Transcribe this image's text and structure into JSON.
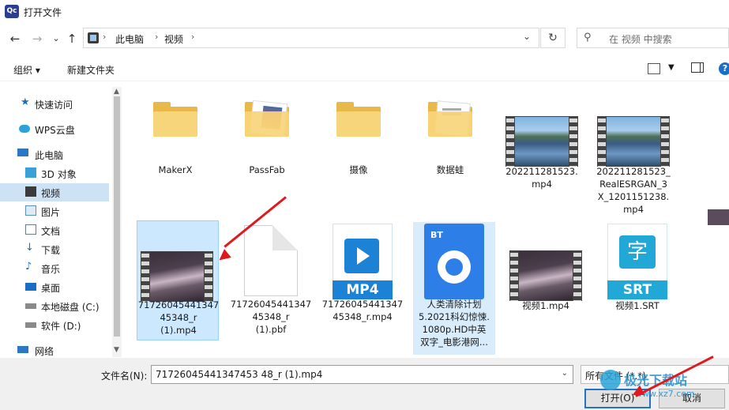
{
  "window": {
    "title": "打开文件",
    "app_icon_text": "Qc"
  },
  "nav": {
    "back": "←",
    "forward": "→",
    "recent": "⌄",
    "up": "↑"
  },
  "address": {
    "crumbs": [
      "此电脑",
      "视频"
    ],
    "separator": "›",
    "dropdown": "⌄",
    "refresh": "↻"
  },
  "search": {
    "placeholder": "在 视频 中搜索",
    "icon": "search-icon"
  },
  "toolbar": {
    "organize": "组织 ▾",
    "new_folder": "新建文件夹",
    "help": "?"
  },
  "sidebar": {
    "items": [
      {
        "label": "快速访问",
        "icon": "star-icon",
        "color": "#1a6fc4"
      },
      {
        "label": "WPS云盘",
        "icon": "cloud-icon",
        "color": "#2aa4d8"
      },
      {
        "label": "此电脑",
        "icon": "computer-icon",
        "color": "#2b79c2"
      },
      {
        "label": "3D 对象",
        "icon": "cube-icon",
        "color": "#3aa0d8"
      },
      {
        "label": "视频",
        "icon": "film-icon",
        "color": "#3b3b3b",
        "selected": true
      },
      {
        "label": "图片",
        "icon": "picture-icon",
        "color": "#5a8fc2"
      },
      {
        "label": "文档",
        "icon": "document-icon",
        "color": "#6b7b8c"
      },
      {
        "label": "下载",
        "icon": "download-icon",
        "color": "#1a6fc4"
      },
      {
        "label": "音乐",
        "icon": "music-icon",
        "color": "#1a6fc4"
      },
      {
        "label": "桌面",
        "icon": "desktop-icon",
        "color": "#1a6fc4"
      },
      {
        "label": "本地磁盘 (C:)",
        "icon": "drive-icon",
        "color": "#555555"
      },
      {
        "label": "软件 (D:)",
        "icon": "drive-icon",
        "color": "#555555"
      },
      {
        "label": "网络",
        "icon": "network-icon",
        "color": "#2b79c2"
      }
    ]
  },
  "files": [
    {
      "name": "MakerX",
      "kind": "folder"
    },
    {
      "name": "PassFab",
      "kind": "folder-docs"
    },
    {
      "name": "摄像",
      "kind": "folder"
    },
    {
      "name": "数据蛙",
      "kind": "folder-docs"
    },
    {
      "name": "202211281523.\nmp4",
      "kind": "video-lake"
    },
    {
      "name": "202211281523_\nRealESRGAN_3\nX_1201151238.\nmp4",
      "kind": "video-lake"
    },
    {
      "name": "71726045441347\n45348_r\n(1).mp4",
      "kind": "video-glow",
      "selected": true
    },
    {
      "name": "71726045441347\n45348_r\n(1).pbf",
      "kind": "blank-doc"
    },
    {
      "name": "71726045441347\n45348_r.mp4",
      "kind": "mp4"
    },
    {
      "name": "人类清除计划\n5.2021科幻惊悚.\n1080p.HD中英\n双字_电影港网...",
      "kind": "bt"
    },
    {
      "name": "视频1.mp4",
      "kind": "video-glow"
    },
    {
      "name": "视频1.SRT",
      "kind": "srt"
    }
  ],
  "icon_labels": {
    "mp4": "MP4",
    "srt": "SRT",
    "srt_char": "字",
    "bt": "BT"
  },
  "footer": {
    "filename_label": "文件名(N):",
    "filename_value": "71726045441347453 48_r (1).mp4",
    "filetype_value": "所有文件 (*.*)",
    "open_label": "打开(O)",
    "cancel_label": "取消"
  },
  "watermark": {
    "text": "极光下载站",
    "url": "www.xz7.com"
  },
  "colors": {
    "accent": "#1a6fc4",
    "selection": "#cce8ff",
    "arrow": "#e0191f"
  }
}
